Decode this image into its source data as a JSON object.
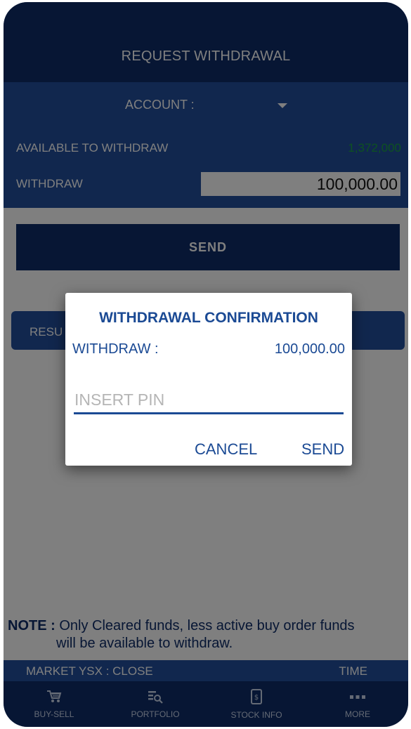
{
  "header": {
    "title": "REQUEST WITHDRAWAL"
  },
  "form": {
    "account_label": "ACCOUNT :",
    "available_label": "AVAILABLE TO WITHDRAW",
    "available_value": "1,372,000",
    "withdraw_label": "WITHDRAW",
    "withdraw_value": "100,000.00",
    "send_label": "SEND",
    "result_label": "RESU"
  },
  "dialog": {
    "title": "WITHDRAWAL CONFIRMATION",
    "withdraw_label": "WITHDRAW :",
    "withdraw_value": "100,000.00",
    "pin_placeholder": "INSERT PIN",
    "cancel_label": "CANCEL",
    "send_label": "SEND"
  },
  "note": {
    "prefix": "NOTE :",
    "line1": "Only Cleared funds, less active buy order funds",
    "line2": "will be available to withdraw."
  },
  "market": {
    "status": "MARKET YSX : CLOSE",
    "time_label": "TIME"
  },
  "tabs": [
    {
      "label": "BUY-SELL",
      "icon": "cart-icon"
    },
    {
      "label": "PORTFOLIO",
      "icon": "portfolio-search-icon"
    },
    {
      "label": "STOCK INFO",
      "icon": "stock-info-icon"
    },
    {
      "label": "MORE",
      "icon": "more-dots-icon"
    }
  ],
  "colors": {
    "navy": "#0e2c68",
    "blue": "#234f9c",
    "green": "#1aa342",
    "dialog_blue": "#1b4a94"
  }
}
